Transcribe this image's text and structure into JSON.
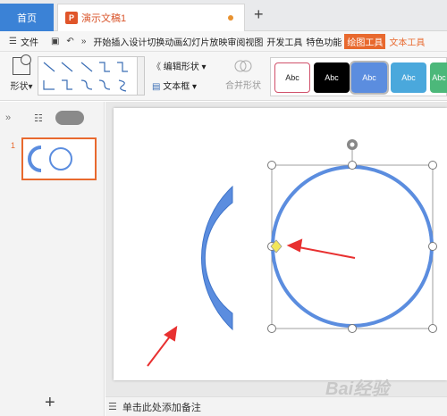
{
  "tabs": {
    "home": "首页",
    "document": "演示文稿1",
    "new_tab": "+"
  },
  "menu": {
    "file": "文件",
    "items": [
      "开始",
      "插入",
      "设计",
      "切换",
      "动画",
      "幻灯片放映",
      "审阅",
      "视图",
      "开发工具",
      "特色功能"
    ],
    "drawing_tools": "绘图工具",
    "text_tools": "文本工具"
  },
  "ribbon": {
    "shape": "形状",
    "edit_shape": "编辑形状",
    "text_box": "文本框",
    "merge_shape": "合并形状",
    "style_samples": [
      "Abc",
      "Abc",
      "Abc",
      "Abc",
      "Abc"
    ]
  },
  "slides": {
    "number": "1"
  },
  "notes": {
    "placeholder": "单击此处添加备注"
  },
  "add_slide": "+",
  "watermark": "Bai经验",
  "colors": {
    "accent": "#e8692e",
    "shape_fill": "#5b8ddf",
    "shape_stroke": "#3f74c9",
    "arrow": "#e83030",
    "handle": "#f2e65a"
  }
}
